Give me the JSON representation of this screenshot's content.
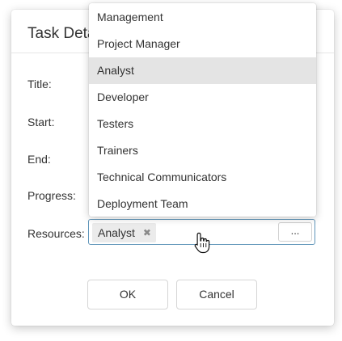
{
  "dialog": {
    "title": "Task Details",
    "labels": {
      "title": "Title:",
      "start": "Start:",
      "end": "End:",
      "progress": "Progress:",
      "resources": "Resources:"
    },
    "resources": {
      "tags": [
        "Analyst"
      ],
      "remove_icon": "close-icon",
      "ellipsis_label": "..."
    },
    "buttons": {
      "ok": "OK",
      "cancel": "Cancel"
    }
  },
  "dropdown": {
    "items": [
      "Management",
      "Project Manager",
      "Analyst",
      "Developer",
      "Testers",
      "Trainers",
      "Technical Communicators",
      "Deployment Team"
    ],
    "selected": "Analyst"
  },
  "colors": {
    "focus_border": "#5f95b9",
    "selected_item_bg": "#e4e4e4",
    "tag_bg": "#ebebeb"
  }
}
